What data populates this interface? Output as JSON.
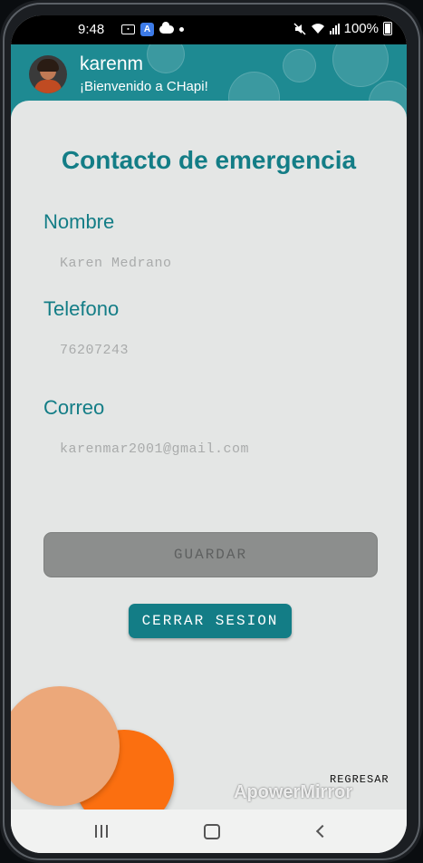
{
  "status_bar": {
    "time": "9:48",
    "battery": "100%",
    "icons": [
      "message-icon",
      "app-icon",
      "cloud-icon",
      "dot-icon",
      "mute-icon",
      "wifi-icon",
      "signal-icon",
      "battery-icon"
    ]
  },
  "header": {
    "username": "karenm",
    "welcome": "¡Bienvenido a CHapi!"
  },
  "form": {
    "title": "Contacto de emergencia",
    "fields": [
      {
        "label": "Nombre",
        "value": "Karen Medrano"
      },
      {
        "label": "Telefono",
        "value": "76207243"
      },
      {
        "label": "Correo",
        "value": "karenmar2001@gmail.com"
      }
    ],
    "save_label": "GUARDAR",
    "logout_label": "CERRAR SESION",
    "back_label": "REGRESAR"
  },
  "watermark": "ApowerMirror",
  "colors": {
    "accent": "#137d86",
    "header_bg": "#1e8a92",
    "orange": "#fb6f10",
    "peach": "#eca87a",
    "disabled_button": "#8c8e8d"
  }
}
